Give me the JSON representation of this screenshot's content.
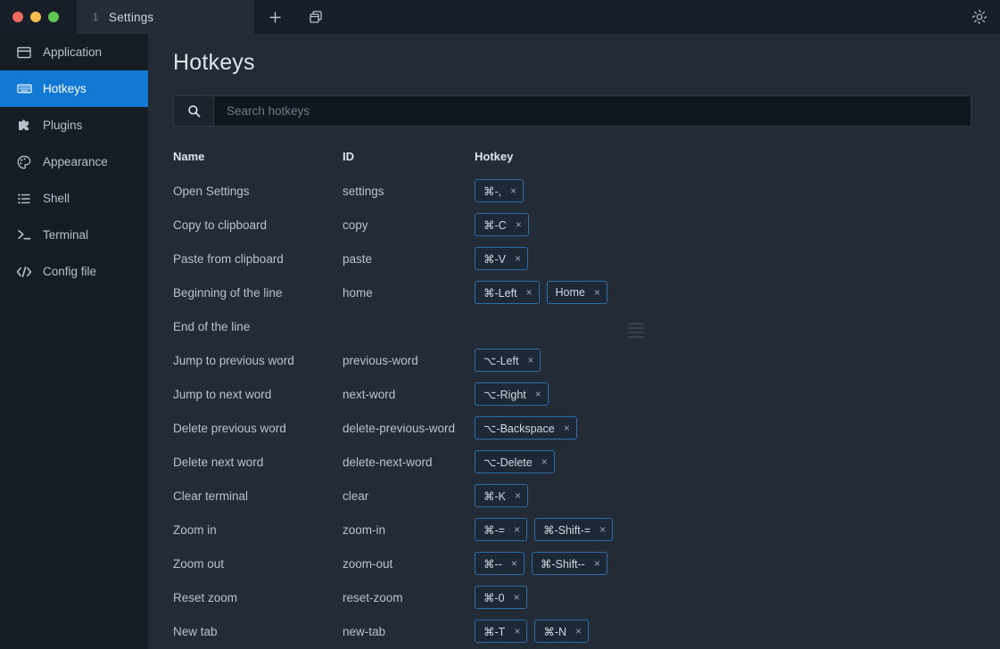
{
  "titlebar": {
    "traffic_lights": [
      "close",
      "minimize",
      "maximize"
    ],
    "tab": {
      "index": "1",
      "title": "Settings"
    },
    "new_tab_label": "+",
    "split_icon": "windows-stack-icon",
    "settings_icon": "gear-icon"
  },
  "sidebar": {
    "items": [
      {
        "label": "Application",
        "icon": "window-icon",
        "active": false
      },
      {
        "label": "Hotkeys",
        "icon": "keyboard-icon",
        "active": true
      },
      {
        "label": "Plugins",
        "icon": "puzzle-icon",
        "active": false
      },
      {
        "label": "Appearance",
        "icon": "palette-icon",
        "active": false
      },
      {
        "label": "Shell",
        "icon": "list-icon",
        "active": false
      },
      {
        "label": "Terminal",
        "icon": "terminal-prompt-icon",
        "active": false
      },
      {
        "label": "Config file",
        "icon": "code-brackets-icon",
        "active": false
      }
    ]
  },
  "main": {
    "title": "Hotkeys",
    "search": {
      "value": "",
      "placeholder": "Search hotkeys",
      "icon": "search-icon"
    },
    "table": {
      "columns": [
        "Name",
        "ID",
        "Hotkey"
      ],
      "rows": [
        {
          "name": "Open Settings",
          "id": "settings",
          "hotkeys": [
            "⌘-,"
          ]
        },
        {
          "name": "Copy to clipboard",
          "id": "copy",
          "hotkeys": [
            "⌘-C"
          ]
        },
        {
          "name": "Paste from clipboard",
          "id": "paste",
          "hotkeys": [
            "⌘-V"
          ]
        },
        {
          "name": "Beginning of the line",
          "id": "home",
          "hotkeys": [
            "⌘-Left",
            "Home"
          ]
        },
        {
          "name": "End of the line",
          "id": "",
          "hotkeys": []
        },
        {
          "name": "Jump to previous word",
          "id": "previous-word",
          "hotkeys": [
            "⌥-Left"
          ]
        },
        {
          "name": "Jump to next word",
          "id": "next-word",
          "hotkeys": [
            "⌥-Right"
          ]
        },
        {
          "name": "Delete previous word",
          "id": "delete-previous-word",
          "hotkeys": [
            "⌥-Backspace"
          ]
        },
        {
          "name": "Delete next word",
          "id": "delete-next-word",
          "hotkeys": [
            "⌥-Delete"
          ]
        },
        {
          "name": "Clear terminal",
          "id": "clear",
          "hotkeys": [
            "⌘-K"
          ]
        },
        {
          "name": "Zoom in",
          "id": "zoom-in",
          "hotkeys": [
            "⌘-=",
            "⌘-Shift-="
          ]
        },
        {
          "name": "Zoom out",
          "id": "zoom-out",
          "hotkeys": [
            "⌘--",
            "⌘-Shift--"
          ]
        },
        {
          "name": "Reset zoom",
          "id": "reset-zoom",
          "hotkeys": [
            "⌘-0"
          ]
        },
        {
          "name": "New tab",
          "id": "new-tab",
          "hotkeys": [
            "⌘-T",
            "⌘-N"
          ]
        }
      ],
      "remove_label": "×",
      "drag_handle_row_index": 4
    }
  },
  "colors": {
    "accent": "#1178d4",
    "chip_border": "#2e6ea8",
    "sidebar_bg": "#161c24",
    "main_bg": "#222b36",
    "titlebar_bg": "#171e27"
  }
}
